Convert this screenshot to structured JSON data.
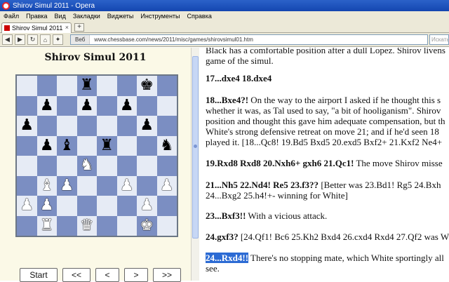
{
  "window": {
    "title": "Shirov Simul 2011 - Opera"
  },
  "menu": [
    "Файл",
    "Правка",
    "Вид",
    "Закладки",
    "Виджеты",
    "Инструменты",
    "Справка"
  ],
  "tabs": [
    {
      "label": "Shirov Simul 2011",
      "close": "×"
    }
  ],
  "newtab_label": "+",
  "address": {
    "badge": "Веб",
    "url": "www.chessbase.com/news/2011/misc/games/shirovsimul01.htm",
    "search_placeholder": "Искать"
  },
  "nav_icons": [
    "back-icon",
    "forward-icon",
    "reload-icon",
    "home-icon",
    "wand-icon"
  ],
  "game": {
    "title": "Shirov Simul 2011",
    "board": [
      [
        "",
        "",
        "",
        "bR",
        "",
        "",
        "bK",
        ""
      ],
      [
        "",
        "bP",
        "",
        "bP",
        "",
        "bP",
        "",
        ""
      ],
      [
        "bP",
        "",
        "",
        "",
        "",
        "",
        "bP",
        ""
      ],
      [
        "",
        "bP",
        "bB",
        "",
        "bR",
        "",
        "",
        "bN"
      ],
      [
        "",
        "",
        "",
        "wN",
        "",
        "",
        "",
        ""
      ],
      [
        "",
        "wB",
        "wP",
        "",
        "",
        "wP",
        "",
        "wP"
      ],
      [
        "wP",
        "wP",
        "",
        "",
        "",
        "",
        "wP",
        ""
      ],
      [
        "",
        "wR",
        "",
        "wQ",
        "",
        "",
        "wK",
        ""
      ]
    ],
    "controls": [
      "Start",
      "<<",
      "<",
      ">",
      ">>"
    ]
  },
  "article": {
    "p0": "Black has a comfortable position after a dull Lopez. Shirov livens",
    "p0b": "game of the simul.",
    "p1": "17...dxe4 18.dxe4",
    "p2_move": "18...Bxe4?!",
    "p2a": " On the way to the airport I asked if he thought this s",
    "p2b": "whether it was, as Tal used to say, \"a bit of hooliganism\". Shirov",
    "p2c": "position and thought this gave him adequate compensation, but th",
    "p2d": "White's strong defensive retreat on move 21; and if he'd seen 18",
    "p2e": "played it. [18...Qc8! 19.Bd5 Bxd5 20.exd5 Bxf2+ 21.Kxf2 Ne4+",
    "p3_move": "19.Rxd8 Rxd8 20.Nxh6+ gxh6 21.Qc1!",
    "p3a": " The move Shirov misse",
    "p4_move": "21...Nh5 22.Nd4! Re5 23.f3??",
    "p4a": " [Better was 23.Bd1! Rg5 24.Bxh",
    "p4b": "24...Bxg2 25.h4!+- winning for White]",
    "p5_move": "23...Bxf3!!",
    "p5a": " With a vicious attack.",
    "p6_move": "24.gxf3?",
    "p6a": " [24.Qf1! Bc6 25.Kh2 Bxd4 26.cxd4 Rxd4 27.Qf2 was W",
    "p7_move": "24...Rxd4!!",
    "p7a": " There's no stopping mate, which White sportingly all",
    "p7b": "see."
  },
  "colors": {
    "board_light": "#e6ebf5",
    "board_dark": "#7b8ec2",
    "pane_bg": "#fbf9e7",
    "highlight": "#2c6bd4"
  }
}
